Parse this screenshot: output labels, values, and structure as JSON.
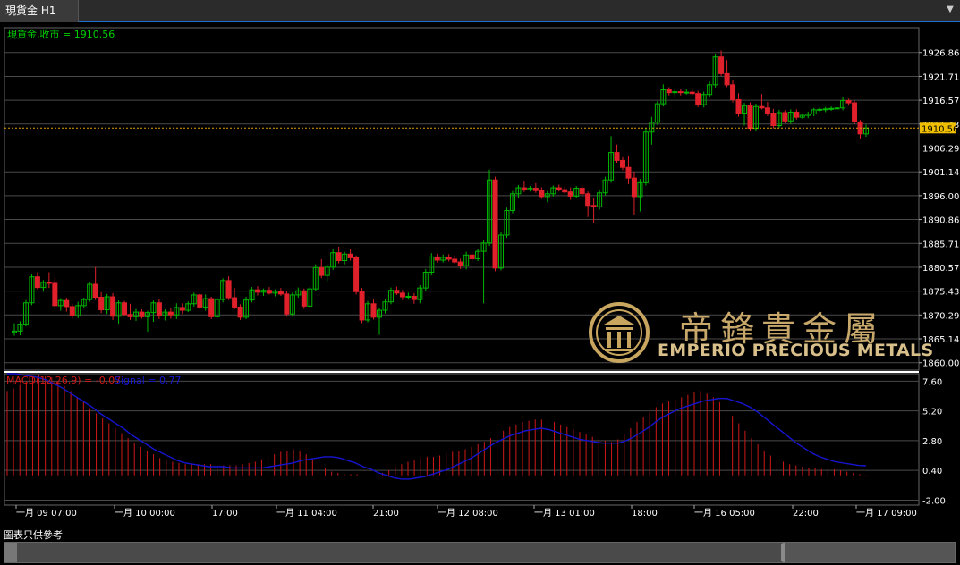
{
  "tab": {
    "title": "現貨金 H1"
  },
  "footer_note": "圖表只供參考",
  "colors": {
    "bull": "#00b800",
    "bear": "#e0202a",
    "grid": "#4a4a4a",
    "price_line": "#e0a000",
    "axis_text": "#ffffff",
    "macd_hist": "#d01818",
    "signal": "#1515d0",
    "title_green": "#00d000"
  },
  "logo": {
    "brand": "EMPERIO PRECIOUS METALS",
    "chinese": "帝鋒貴金屬"
  },
  "chart_data": [
    {
      "type": "candlestick",
      "title": "現貨金,收市 = 1910.56",
      "last_price": 1910.56,
      "ylim": [
        1858.4,
        1932.2
      ],
      "y_ticks": [
        "1926.86",
        "1921.71",
        "1916.57",
        "1911.43",
        "1906.29",
        "1901.14",
        "1896.00",
        "1890.86",
        "1885.71",
        "1880.57",
        "1875.43",
        "1870.29",
        "1865.14",
        "1860.00"
      ],
      "grid": true,
      "candles": [
        [
          1866.5,
          1868.5,
          1865.8,
          1866.8
        ],
        [
          1866.8,
          1868.9,
          1865.9,
          1868.3
        ],
        [
          1868.3,
          1873.5,
          1867.8,
          1872.9
        ],
        [
          1872.9,
          1879.2,
          1872.4,
          1878.5
        ],
        [
          1878.5,
          1879.5,
          1875.8,
          1876.2
        ],
        [
          1876.2,
          1877.8,
          1875.3,
          1877.3
        ],
        [
          1877.3,
          1879.5,
          1876.1,
          1877.1
        ],
        [
          1877.1,
          1878.4,
          1871.6,
          1872.3
        ],
        [
          1872.3,
          1873.9,
          1871.2,
          1873.4
        ],
        [
          1873.4,
          1874.0,
          1871.0,
          1872.1
        ],
        [
          1872.1,
          1872.7,
          1869.5,
          1870.1
        ],
        [
          1870.1,
          1873.1,
          1869.6,
          1872.3
        ],
        [
          1872.3,
          1874.0,
          1871.8,
          1873.6
        ],
        [
          1873.6,
          1877.4,
          1873.1,
          1876.9
        ],
        [
          1876.9,
          1880.6,
          1873.5,
          1874.1
        ],
        [
          1874.1,
          1875.2,
          1870.7,
          1871.4
        ],
        [
          1871.4,
          1874.8,
          1870.5,
          1874.2
        ],
        [
          1874.2,
          1875.0,
          1869.2,
          1870.0
        ],
        [
          1870.0,
          1873.4,
          1868.4,
          1872.9
        ],
        [
          1872.9,
          1873.3,
          1870.0,
          1870.4
        ],
        [
          1870.4,
          1872.7,
          1869.2,
          1869.9
        ],
        [
          1869.9,
          1871.6,
          1869.0,
          1870.9
        ],
        [
          1870.9,
          1871.5,
          1869.5,
          1869.9
        ],
        [
          1869.9,
          1871.2,
          1866.7,
          1870.8
        ],
        [
          1870.8,
          1873.4,
          1868.8,
          1872.9
        ],
        [
          1872.9,
          1873.8,
          1869.4,
          1870.1
        ],
        [
          1870.1,
          1871.5,
          1869.1,
          1870.9
        ],
        [
          1870.9,
          1871.7,
          1869.5,
          1870.3
        ],
        [
          1870.3,
          1872.8,
          1869.4,
          1871.9
        ],
        [
          1871.9,
          1872.8,
          1870.5,
          1871.3
        ],
        [
          1871.3,
          1873.2,
          1870.9,
          1872.7
        ],
        [
          1872.7,
          1875.1,
          1872.1,
          1874.6
        ],
        [
          1874.6,
          1874.9,
          1871.6,
          1872.0
        ],
        [
          1872.0,
          1874.7,
          1871.2,
          1873.8
        ],
        [
          1873.8,
          1874.2,
          1869.4,
          1869.9
        ],
        [
          1869.9,
          1874.1,
          1869.5,
          1873.6
        ],
        [
          1873.6,
          1878.2,
          1873.0,
          1877.7
        ],
        [
          1877.7,
          1878.6,
          1873.5,
          1874.0
        ],
        [
          1874.0,
          1876.1,
          1871.5,
          1872.0
        ],
        [
          1872.0,
          1872.6,
          1869.2,
          1869.8
        ],
        [
          1869.8,
          1874.2,
          1869.4,
          1873.5
        ],
        [
          1873.5,
          1876.3,
          1873.0,
          1875.7
        ],
        [
          1875.7,
          1876.5,
          1874.5,
          1875.2
        ],
        [
          1875.2,
          1876.0,
          1874.4,
          1875.6
        ],
        [
          1875.6,
          1876.3,
          1874.7,
          1875.0
        ],
        [
          1875.0,
          1875.8,
          1874.3,
          1875.4
        ],
        [
          1875.4,
          1876.1,
          1874.4,
          1874.8
        ],
        [
          1874.8,
          1875.4,
          1869.9,
          1870.5
        ],
        [
          1870.5,
          1875.1,
          1869.9,
          1874.6
        ],
        [
          1874.6,
          1876.2,
          1874.0,
          1875.5
        ],
        [
          1875.5,
          1876.0,
          1871.6,
          1872.2
        ],
        [
          1872.2,
          1876.4,
          1871.8,
          1875.9
        ],
        [
          1875.9,
          1881.2,
          1875.4,
          1880.5
        ],
        [
          1880.5,
          1882.3,
          1878.2,
          1878.8
        ],
        [
          1878.8,
          1881.2,
          1877.6,
          1880.6
        ],
        [
          1880.6,
          1884.6,
          1880.0,
          1883.7
        ],
        [
          1883.7,
          1885.0,
          1881.4,
          1882.0
        ],
        [
          1882.0,
          1883.9,
          1881.2,
          1883.4
        ],
        [
          1883.4,
          1884.6,
          1882.0,
          1882.6
        ],
        [
          1882.6,
          1883.1,
          1874.7,
          1875.3
        ],
        [
          1875.3,
          1876.1,
          1868.5,
          1869.2
        ],
        [
          1869.2,
          1873.3,
          1868.7,
          1872.7
        ],
        [
          1872.7,
          1873.6,
          1869.3,
          1869.8
        ],
        [
          1869.8,
          1871.9,
          1866.0,
          1871.3
        ],
        [
          1871.3,
          1873.7,
          1870.6,
          1873.1
        ],
        [
          1873.1,
          1876.2,
          1872.6,
          1875.6
        ],
        [
          1875.6,
          1876.4,
          1874.6,
          1875.0
        ],
        [
          1875.0,
          1875.7,
          1873.5,
          1874.2
        ],
        [
          1874.2,
          1875.1,
          1873.6,
          1874.3
        ],
        [
          1874.3,
          1875.0,
          1872.7,
          1873.6
        ],
        [
          1873.6,
          1876.7,
          1872.8,
          1876.1
        ],
        [
          1876.1,
          1880.2,
          1875.5,
          1879.5
        ],
        [
          1879.5,
          1883.6,
          1878.8,
          1882.8
        ],
        [
          1882.8,
          1883.5,
          1881.6,
          1882.1
        ],
        [
          1882.1,
          1883.3,
          1881.6,
          1882.7
        ],
        [
          1882.7,
          1883.4,
          1881.8,
          1882.3
        ],
        [
          1882.3,
          1883.1,
          1881.3,
          1881.7
        ],
        [
          1881.7,
          1882.4,
          1880.2,
          1880.9
        ],
        [
          1880.9,
          1883.9,
          1880.1,
          1883.2
        ],
        [
          1883.2,
          1883.8,
          1881.9,
          1882.4
        ],
        [
          1882.4,
          1884.6,
          1881.9,
          1884.0
        ],
        [
          1884.0,
          1886.4,
          1872.8,
          1885.8
        ],
        [
          1885.8,
          1901.6,
          1885.2,
          1899.4
        ],
        [
          1899.4,
          1900.1,
          1879.7,
          1880.4
        ],
        [
          1880.4,
          1888.1,
          1879.9,
          1887.5
        ],
        [
          1887.5,
          1893.4,
          1886.9,
          1892.8
        ],
        [
          1892.8,
          1897.0,
          1892.2,
          1896.4
        ],
        [
          1896.4,
          1898.3,
          1895.6,
          1897.7
        ],
        [
          1897.7,
          1899.2,
          1896.8,
          1897.3
        ],
        [
          1897.3,
          1898.1,
          1896.9,
          1897.6
        ],
        [
          1897.6,
          1898.7,
          1896.6,
          1897.1
        ],
        [
          1897.1,
          1897.8,
          1895.3,
          1895.8
        ],
        [
          1895.8,
          1897.0,
          1894.6,
          1896.4
        ],
        [
          1896.4,
          1898.2,
          1895.8,
          1897.7
        ],
        [
          1897.7,
          1898.4,
          1896.9,
          1897.3
        ],
        [
          1897.3,
          1897.9,
          1896.4,
          1896.8
        ],
        [
          1896.8,
          1897.8,
          1895.1,
          1895.9
        ],
        [
          1895.9,
          1898.1,
          1895.5,
          1897.6
        ],
        [
          1897.6,
          1898.3,
          1895.8,
          1896.4
        ],
        [
          1896.4,
          1896.9,
          1891.4,
          1893.9
        ],
        [
          1893.9,
          1895.4,
          1890.2,
          1893.6
        ],
        [
          1893.6,
          1897.2,
          1893.0,
          1896.6
        ],
        [
          1896.6,
          1900.1,
          1896.0,
          1899.4
        ],
        [
          1899.4,
          1908.8,
          1898.8,
          1905.3
        ],
        [
          1905.3,
          1907.0,
          1903.1,
          1903.6
        ],
        [
          1903.6,
          1904.3,
          1901.5,
          1902.1
        ],
        [
          1902.1,
          1904.5,
          1898.5,
          1899.8
        ],
        [
          1899.8,
          1901.2,
          1891.8,
          1895.8
        ],
        [
          1895.8,
          1899.6,
          1892.6,
          1898.8
        ],
        [
          1898.8,
          1910.6,
          1898.2,
          1909.7
        ],
        [
          1909.7,
          1913.0,
          1907.0,
          1911.8
        ],
        [
          1911.8,
          1916.4,
          1911.2,
          1915.8
        ],
        [
          1915.8,
          1920.0,
          1915.2,
          1918.8
        ],
        [
          1918.8,
          1919.4,
          1917.6,
          1918.2
        ],
        [
          1918.2,
          1918.9,
          1917.4,
          1918.4
        ],
        [
          1918.4,
          1918.9,
          1917.6,
          1918.2
        ],
        [
          1918.2,
          1919.0,
          1917.8,
          1918.3
        ],
        [
          1918.3,
          1919.0,
          1917.7,
          1918.0
        ],
        [
          1918.0,
          1918.6,
          1915.1,
          1915.6
        ],
        [
          1915.6,
          1918.4,
          1915.0,
          1917.8
        ],
        [
          1917.8,
          1920.6,
          1917.2,
          1919.9
        ],
        [
          1919.9,
          1926.6,
          1919.3,
          1925.9
        ],
        [
          1925.9,
          1927.3,
          1921.8,
          1922.3
        ],
        [
          1922.3,
          1925.2,
          1919.4,
          1919.9
        ],
        [
          1919.9,
          1920.9,
          1916.1,
          1916.7
        ],
        [
          1916.7,
          1918.1,
          1913.0,
          1913.8
        ],
        [
          1913.8,
          1916.0,
          1911.1,
          1915.4
        ],
        [
          1915.4,
          1916.1,
          1909.9,
          1910.5
        ],
        [
          1910.5,
          1915.8,
          1910.0,
          1915.2
        ],
        [
          1915.2,
          1917.9,
          1914.6,
          1914.9
        ],
        [
          1914.9,
          1916.2,
          1913.2,
          1913.8
        ],
        [
          1913.8,
          1914.7,
          1910.5,
          1911.1
        ],
        [
          1911.1,
          1914.5,
          1910.5,
          1913.9
        ],
        [
          1913.9,
          1914.4,
          1911.6,
          1912.1
        ],
        [
          1912.1,
          1914.6,
          1911.5,
          1914.0
        ],
        [
          1914.0,
          1914.6,
          1912.4,
          1912.9
        ],
        [
          1912.9,
          1913.7,
          1912.6,
          1913.3
        ],
        [
          1913.3,
          1914.1,
          1912.7,
          1913.6
        ],
        [
          1913.6,
          1914.9,
          1913.1,
          1914.5
        ],
        [
          1914.5,
          1915.0,
          1914.0,
          1914.6
        ],
        [
          1914.6,
          1915.1,
          1914.0,
          1914.7
        ],
        [
          1914.7,
          1915.2,
          1914.3,
          1914.8
        ],
        [
          1914.8,
          1915.1,
          1914.4,
          1914.9
        ],
        [
          1914.9,
          1917.3,
          1914.4,
          1916.5
        ],
        [
          1916.5,
          1916.9,
          1915.4,
          1916.0
        ],
        [
          1916.0,
          1916.5,
          1911.4,
          1911.9
        ],
        [
          1911.9,
          1912.3,
          1908.2,
          1909.3
        ],
        [
          1909.3,
          1911.3,
          1908.7,
          1910.56
        ]
      ]
    },
    {
      "type": "macd",
      "title": "MACD(12,26,9) = -0.07",
      "signal_label": "Signal = 0.77",
      "ylim": [
        -2.4,
        8.2
      ],
      "y_ticks": [
        "7.60",
        "5.20",
        "2.80",
        "0.40",
        "-2.00"
      ],
      "grid": true,
      "macd": [
        6.8,
        7.0,
        7.3,
        7.6,
        8.0,
        8.1,
        8.0,
        7.9,
        7.6,
        7.2,
        6.8,
        6.3,
        5.9,
        5.4,
        5.0,
        4.6,
        4.2,
        3.8,
        3.4,
        3.0,
        2.6,
        2.3,
        2.0,
        1.7,
        1.4,
        1.2,
        1.1,
        1.0,
        0.9,
        0.9,
        0.9,
        0.9,
        0.9,
        0.8,
        0.8,
        0.8,
        0.8,
        0.9,
        1.0,
        1.1,
        1.3,
        1.5,
        1.7,
        1.9,
        2.0,
        2.1,
        2.0,
        1.7,
        1.3,
        0.9,
        0.6,
        0.3,
        0.2,
        0.1,
        0.1,
        0.1,
        0.0,
        -0.1,
        0.0,
        0.2,
        0.4,
        0.7,
        0.9,
        1.1,
        1.2,
        1.4,
        1.5,
        1.5,
        1.6,
        1.8,
        1.9,
        2.0,
        2.1,
        2.3,
        2.5,
        2.7,
        3.0,
        3.3,
        3.6,
        3.9,
        4.1,
        4.3,
        4.4,
        4.5,
        4.5,
        4.4,
        4.3,
        4.1,
        3.9,
        3.7,
        3.5,
        3.3,
        3.1,
        2.9,
        2.8,
        2.7,
        2.9,
        3.3,
        3.8,
        4.3,
        4.7,
        5.1,
        5.5,
        5.8,
        6.0,
        6.1,
        6.3,
        6.5,
        6.7,
        6.8,
        6.6,
        6.3,
        5.9,
        5.4,
        4.8,
        4.2,
        3.6,
        3.0,
        2.5,
        2.0,
        1.6,
        1.3,
        1.1,
        0.9,
        0.8,
        0.7,
        0.6,
        0.6,
        0.5,
        0.5,
        0.5,
        0.4,
        0.3,
        0.2,
        0.1,
        -0.07
      ],
      "signal": [
        8.2,
        8.2,
        8.1,
        8.0,
        7.9,
        7.7,
        7.4,
        7.1,
        6.7,
        6.3,
        5.9,
        5.5,
        5.0,
        4.6,
        4.2,
        3.8,
        3.3,
        2.9,
        2.5,
        2.1,
        1.8,
        1.5,
        1.2,
        1.0,
        0.9,
        0.8,
        0.7,
        0.7,
        0.7,
        0.6,
        0.6,
        0.6,
        0.6,
        0.6,
        0.7,
        0.8,
        0.9,
        1.0,
        1.2,
        1.3,
        1.4,
        1.5,
        1.5,
        1.4,
        1.2,
        1.0,
        0.7,
        0.5,
        0.2,
        0.0,
        -0.2,
        -0.3,
        -0.3,
        -0.2,
        -0.1,
        0.1,
        0.3,
        0.5,
        0.8,
        1.1,
        1.4,
        1.8,
        2.2,
        2.6,
        2.9,
        3.2,
        3.4,
        3.6,
        3.7,
        3.8,
        3.7,
        3.5,
        3.3,
        3.1,
        2.9,
        2.8,
        2.7,
        2.6,
        2.6,
        2.6,
        2.8,
        3.1,
        3.5,
        3.9,
        4.4,
        4.8,
        5.1,
        5.4,
        5.6,
        5.8,
        6.0,
        6.1,
        6.2,
        6.2,
        6.0,
        5.8,
        5.5,
        5.1,
        4.6,
        4.1,
        3.6,
        3.1,
        2.6,
        2.2,
        1.8,
        1.5,
        1.3,
        1.1,
        1.0,
        0.9,
        0.8,
        0.77
      ]
    }
  ],
  "x_labels": [
    "一月 09 07:00",
    "一月 10 00:00",
    "17:00",
    "一月 11 04:00",
    "21:00",
    "一月 12 08:00",
    "一月 13 01:00",
    "18:00",
    "一月 16 05:00",
    "22:00",
    "一月 17 09:00"
  ]
}
